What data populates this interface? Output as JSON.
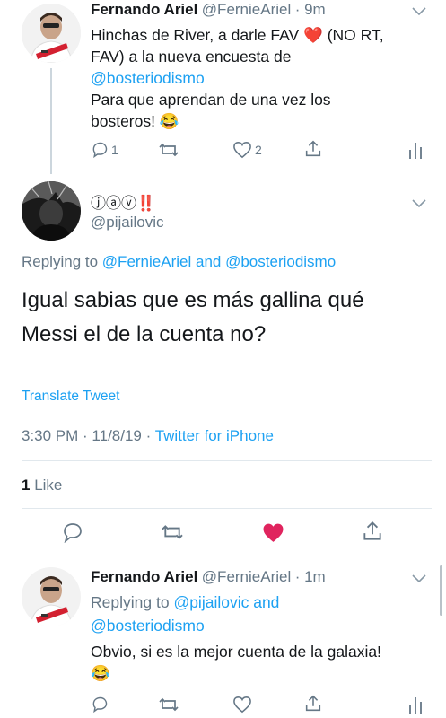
{
  "tweet1": {
    "name": "Fernando Ariel",
    "handle": "@FernieAriel",
    "time": "· 9m",
    "line1": "Hinchas de River, a darle FAV",
    "heart_emoji": "❤️",
    "line1b": " (NO RT,",
    "line2": "FAV) a la nueva encuesta de",
    "mention": "@bosteriodismo",
    "line4": "Para que aprendan de una vez los",
    "line5": "bosteros!",
    "emoji": "😂",
    "reply_count": "1",
    "like_count": "2"
  },
  "main_tweet": {
    "name": "ⓙⓐⓥ‼️",
    "handle": "@pijailovic",
    "replying_prefix": "Replying to",
    "replying_user1": "@FernieAriel",
    "replying_and": "and",
    "replying_user2": "@bosteriodismo",
    "text_line1": "Igual sabias que es más gallina qué",
    "text_line2": "Messi el de la cuenta no?",
    "translate": "Translate Tweet",
    "timestamp": "3:30 PM · 11/8/19 ·",
    "source": "Twitter for iPhone",
    "likes_count": "1",
    "likes_label": "Like"
  },
  "tweet3": {
    "name": "Fernando Ariel",
    "handle": "@FernieAriel",
    "time": "· 1m",
    "replying_prefix": "Replying to",
    "replying_user1": "@pijailovic",
    "replying_and": "and",
    "replying_user2": "@bosteriodismo",
    "text": "Obvio, si es la mejor cuenta de la galaxia!",
    "emoji": "😂"
  },
  "colors": {
    "accent": "#1da1f2",
    "like": "#e0245e",
    "gray": "#657786"
  }
}
